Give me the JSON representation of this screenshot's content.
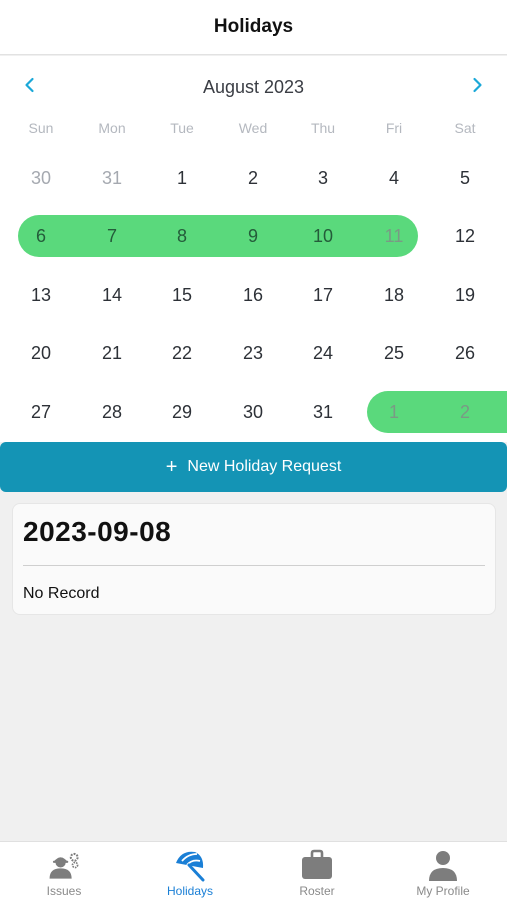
{
  "header": {
    "title": "Holidays"
  },
  "calendar": {
    "month_label": "August 2023",
    "prev_icon": "chevron-left-icon",
    "next_icon": "chevron-right-icon",
    "accent_color": "#1ba8d8",
    "range_color": "#5ad97c",
    "weekdays": [
      "Sun",
      "Mon",
      "Tue",
      "Wed",
      "Thu",
      "Fri",
      "Sat"
    ],
    "weeks": [
      [
        {
          "label": "30",
          "muted": true,
          "selected": false
        },
        {
          "label": "31",
          "muted": true,
          "selected": false
        },
        {
          "label": "1",
          "muted": false,
          "selected": false
        },
        {
          "label": "2",
          "muted": false,
          "selected": false
        },
        {
          "label": "3",
          "muted": false,
          "selected": false
        },
        {
          "label": "4",
          "muted": false,
          "selected": false
        },
        {
          "label": "5",
          "muted": false,
          "selected": false
        }
      ],
      [
        {
          "label": "6",
          "muted": false,
          "selected": true
        },
        {
          "label": "7",
          "muted": false,
          "selected": true
        },
        {
          "label": "8",
          "muted": false,
          "selected": true
        },
        {
          "label": "9",
          "muted": false,
          "selected": true
        },
        {
          "label": "10",
          "muted": false,
          "selected": true
        },
        {
          "label": "11",
          "muted": true,
          "selected": true
        },
        {
          "label": "12",
          "muted": false,
          "selected": false
        }
      ],
      [
        {
          "label": "13",
          "muted": false,
          "selected": false
        },
        {
          "label": "14",
          "muted": false,
          "selected": false
        },
        {
          "label": "15",
          "muted": false,
          "selected": false
        },
        {
          "label": "16",
          "muted": false,
          "selected": false
        },
        {
          "label": "17",
          "muted": false,
          "selected": false
        },
        {
          "label": "18",
          "muted": false,
          "selected": false
        },
        {
          "label": "19",
          "muted": false,
          "selected": false
        }
      ],
      [
        {
          "label": "20",
          "muted": false,
          "selected": false
        },
        {
          "label": "21",
          "muted": false,
          "selected": false
        },
        {
          "label": "22",
          "muted": false,
          "selected": false
        },
        {
          "label": "23",
          "muted": false,
          "selected": false
        },
        {
          "label": "24",
          "muted": false,
          "selected": false
        },
        {
          "label": "25",
          "muted": false,
          "selected": false
        },
        {
          "label": "26",
          "muted": false,
          "selected": false
        }
      ],
      [
        {
          "label": "27",
          "muted": false,
          "selected": false
        },
        {
          "label": "28",
          "muted": false,
          "selected": false
        },
        {
          "label": "29",
          "muted": false,
          "selected": false
        },
        {
          "label": "30",
          "muted": false,
          "selected": false
        },
        {
          "label": "31",
          "muted": false,
          "selected": false
        },
        {
          "label": "1",
          "muted": true,
          "selected": true
        },
        {
          "label": "2",
          "muted": true,
          "selected": true
        }
      ]
    ]
  },
  "new_request": {
    "icon": "plus-icon",
    "plus": "+",
    "label": "New Holiday Request"
  },
  "record": {
    "date": "2023-09-08",
    "empty_text": "No Record"
  },
  "tabbar": {
    "active_color": "#1a7fd6",
    "items": [
      {
        "label": "Issues",
        "icon": "worker-gear-icon",
        "active": false
      },
      {
        "label": "Holidays",
        "icon": "beach-umbrella-icon",
        "active": true
      },
      {
        "label": "Roster",
        "icon": "briefcase-icon",
        "active": false
      },
      {
        "label": "My Profile",
        "icon": "person-icon",
        "active": false
      }
    ]
  }
}
